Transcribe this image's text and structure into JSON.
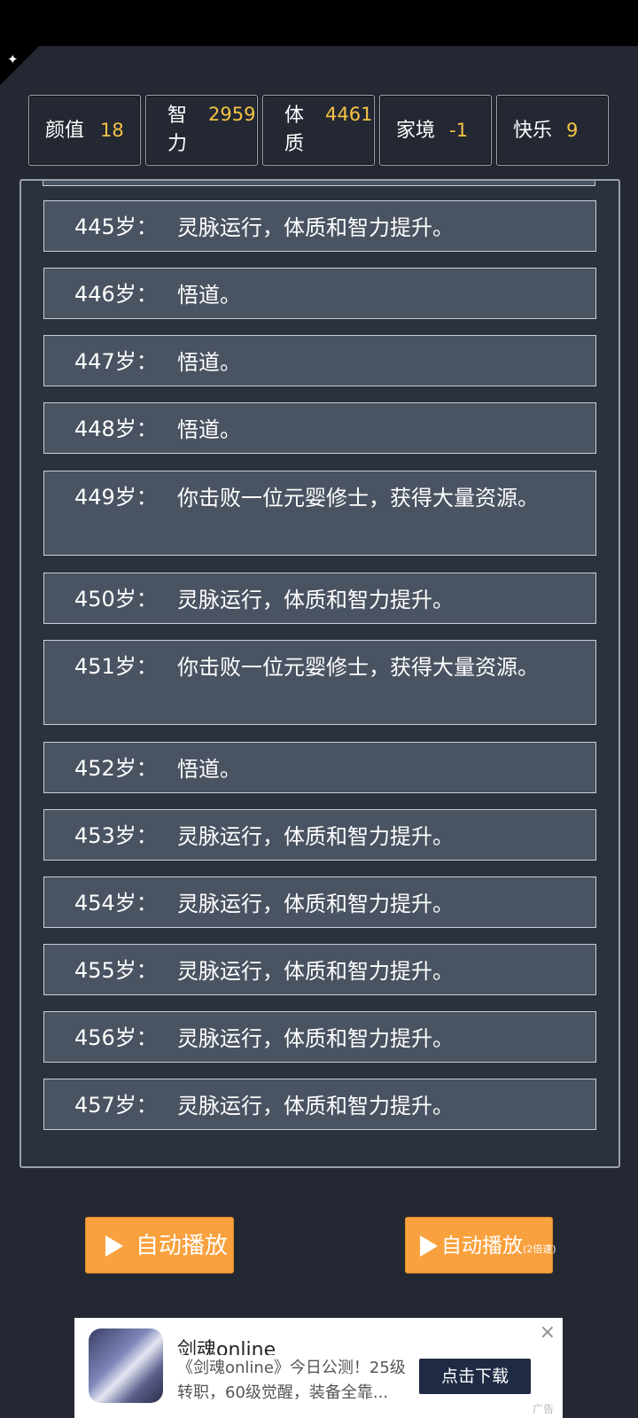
{
  "stats": [
    {
      "label": "颜值",
      "value": "18"
    },
    {
      "label": "智力",
      "value": "2959"
    },
    {
      "label": "体质",
      "value": "4461"
    },
    {
      "label": "家境",
      "value": "-1"
    },
    {
      "label": "快乐",
      "value": "9"
    }
  ],
  "log": [
    {
      "age": "445岁：",
      "text": "灵脉运行，体质和智力提升。"
    },
    {
      "age": "446岁：",
      "text": "悟道。"
    },
    {
      "age": "447岁：",
      "text": "悟道。"
    },
    {
      "age": "448岁：",
      "text": "悟道。"
    },
    {
      "age": "449岁：",
      "text": "你击败一位元婴修士，获得大量资源。"
    },
    {
      "age": "450岁：",
      "text": "灵脉运行，体质和智力提升。"
    },
    {
      "age": "451岁：",
      "text": "你击败一位元婴修士，获得大量资源。"
    },
    {
      "age": "452岁：",
      "text": "悟道。"
    },
    {
      "age": "453岁：",
      "text": "灵脉运行，体质和智力提升。"
    },
    {
      "age": "454岁：",
      "text": "灵脉运行，体质和智力提升。"
    },
    {
      "age": "455岁：",
      "text": "灵脉运行，体质和智力提升。"
    },
    {
      "age": "456岁：",
      "text": "灵脉运行，体质和智力提升。"
    },
    {
      "age": "457岁：",
      "text": "灵脉运行，体质和智力提升。"
    }
  ],
  "buttons": {
    "autoplay": "自动播放",
    "autoplay_fast": "自动播放",
    "autoplay_fast_suffix": "(2倍速)"
  },
  "ad": {
    "title": "剑魂online",
    "description": "《剑魂online》今日公测！25级转职，60级觉醒，装备全靠...",
    "cta": "点击下载",
    "tag": "广告",
    "close": "×"
  },
  "colors": {
    "background": "#232833",
    "card": "#4a5362",
    "accent": "#f9a13e",
    "value_yellow": "#f6c344"
  },
  "icons": {
    "corner": "pin-icon",
    "play": "play-icon",
    "close": "close-icon"
  }
}
